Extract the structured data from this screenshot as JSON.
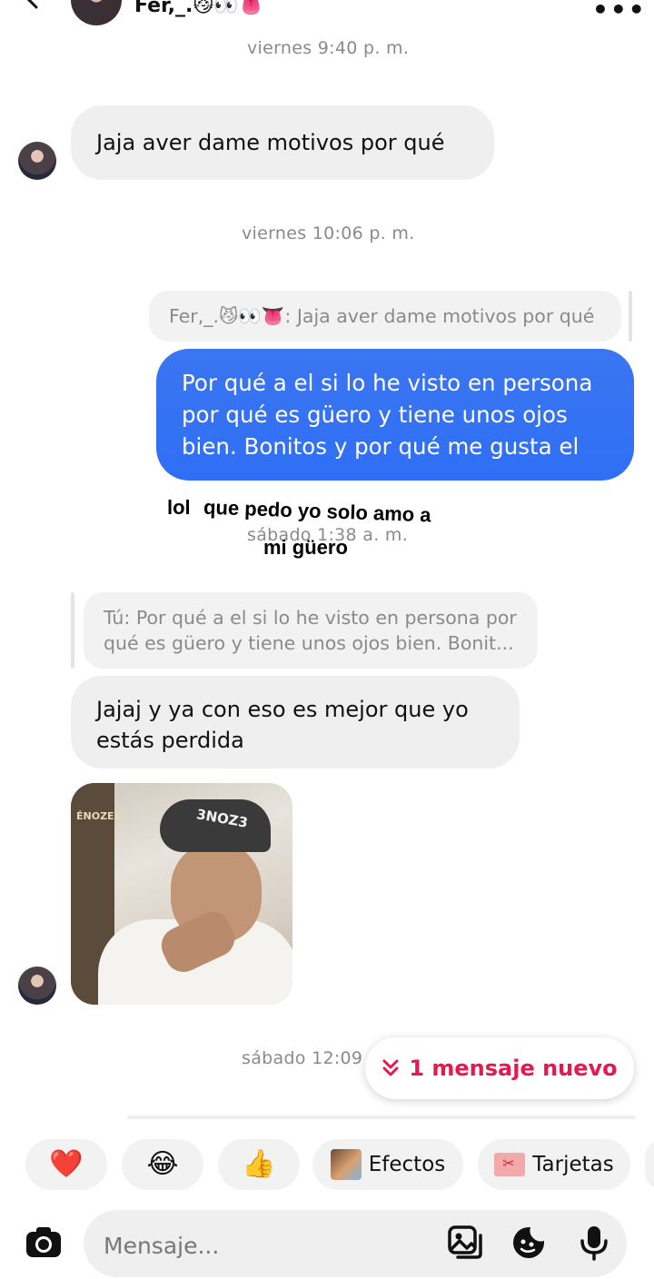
{
  "header": {
    "title": "Fer,_.😼👀👅"
  },
  "messages": {
    "ts1": "viernes 9:40 p. m.",
    "msg1": "Jaja aver dame motivos por qué",
    "ts2": "viernes 10:06 p. m.",
    "reply1_preview": "Fer,_.😼👀👅: Jaja aver dame motivos por qué",
    "out1_line1": "Por qué a el si lo he visto en persona",
    "out1_line2": "por qué es güero y tiene unos ojos",
    "out1_line3": "bien. Bonitos y por qué me gusta el",
    "ts3": "sábado 1:38 a. m.",
    "reply2_line1": "Tú: Por qué a el si lo he visto en persona por",
    "reply2_line2": "qué es güero y tiene unos ojos bien. Bonit...",
    "msg2_line1": "Jajaj y ya con eso es mejor que yo",
    "msg2_line2": "estás perdida",
    "photo_cap_text": "3NOZ3",
    "photo_logo_text": "ÉNOZES",
    "ts4": "sábado 12:09"
  },
  "overlay": {
    "word1": "lol",
    "line1": "que pedo yo solo amo a",
    "line2": "mi güero"
  },
  "new_message_pill": {
    "label": "1 mensaje nuevo"
  },
  "quick_reactions": [
    {
      "glyph": "❤️"
    },
    {
      "glyph": "😂"
    },
    {
      "glyph": "👍"
    }
  ],
  "chips": {
    "effects": "Efectos",
    "cards": "Tarjetas"
  },
  "composer": {
    "placeholder": "Mensaje..."
  },
  "colors": {
    "outgoing_bubble": "#3b76f1",
    "accent_new_message": "#e6194f"
  }
}
